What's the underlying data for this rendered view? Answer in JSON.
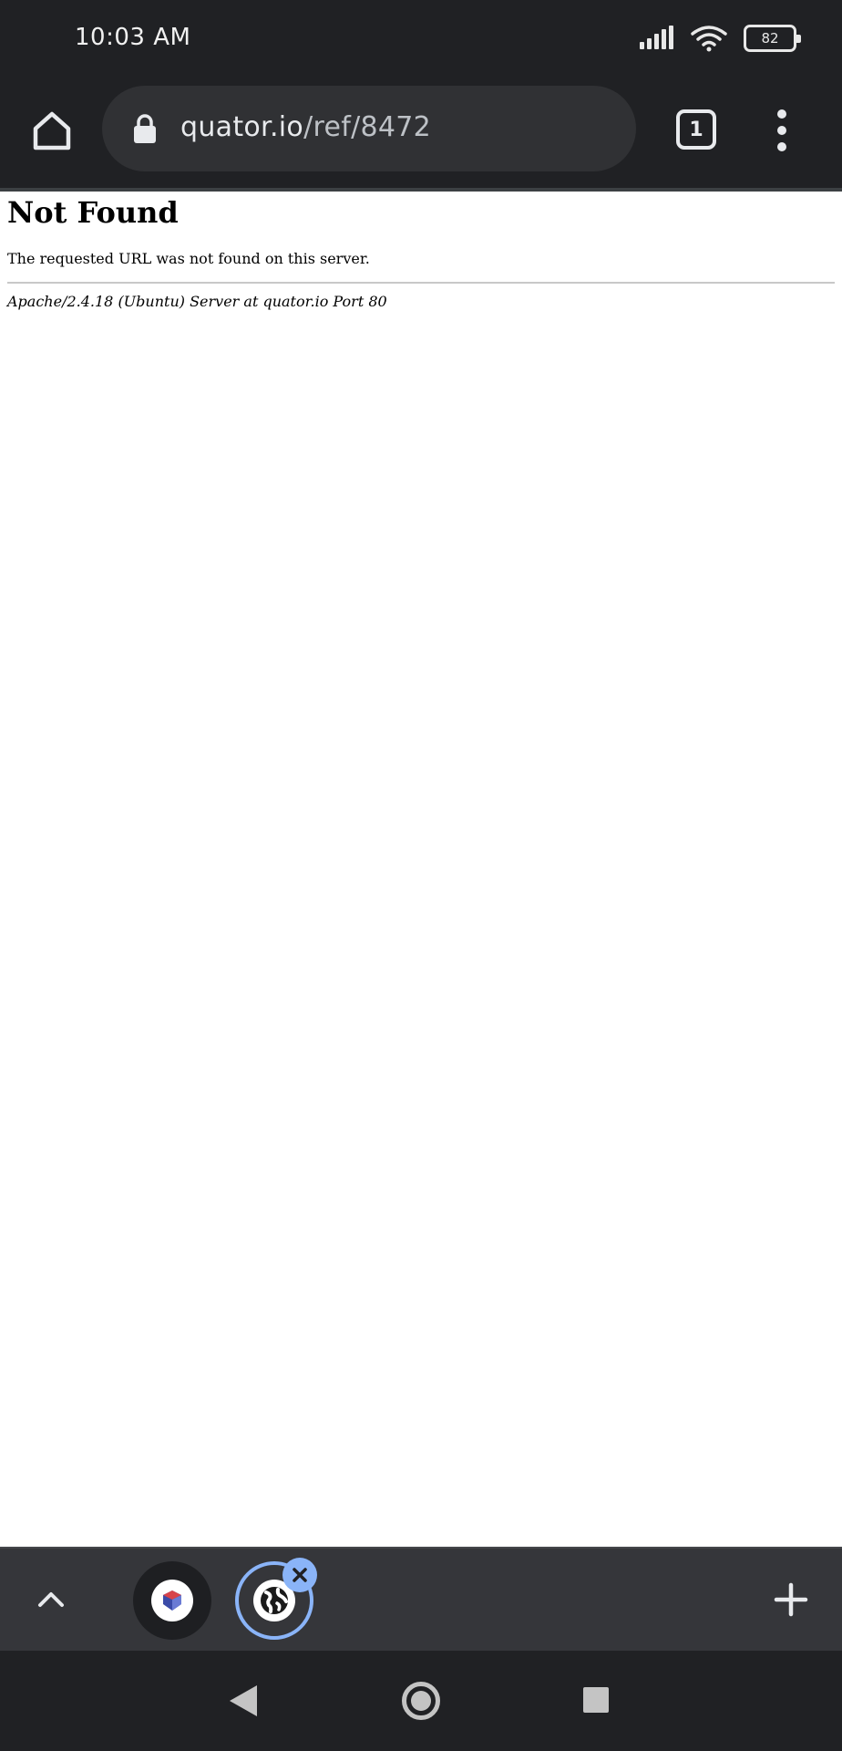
{
  "status_bar": {
    "time": "10:03 AM",
    "battery_level": "82",
    "icons": [
      "signal-icon",
      "wifi-icon",
      "battery-icon"
    ]
  },
  "toolbar": {
    "url_host": "quator.io",
    "url_path": "/ref/8472",
    "tab_count": "1",
    "icons": [
      "home-icon",
      "lock-icon",
      "more-vert-icon"
    ]
  },
  "page": {
    "title": "Not Found",
    "message": "The requested URL was not found on this server.",
    "server_signature": "Apache/2.4.18 (Ubuntu) Server at quator.io Port 80"
  },
  "tab_strip": {
    "icons": [
      "chevron-up-icon",
      "site-favicon-icon",
      "globe-icon",
      "close-icon",
      "plus-icon"
    ],
    "accent_color": "#8ab4f8"
  },
  "nav_bar": {
    "icons": [
      "back-icon",
      "home-circle-icon",
      "recents-icon"
    ]
  },
  "colors": {
    "chrome_dark": "#202124",
    "omnibox": "#303134",
    "tab_strip": "#35363a"
  }
}
